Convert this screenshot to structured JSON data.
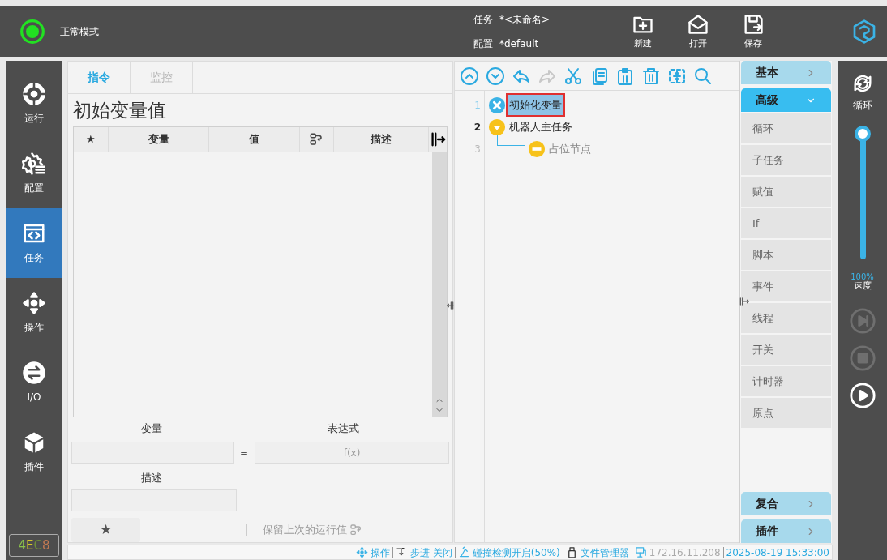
{
  "top_bar": {
    "mode": "正常模式",
    "task_label": "任务",
    "task_value": "*<未命名>",
    "config_label": "配置",
    "config_value": "*default",
    "actions": [
      {
        "kind": "new",
        "label": "新建"
      },
      {
        "kind": "open",
        "label": "打开"
      },
      {
        "kind": "save",
        "label": "保存"
      }
    ]
  },
  "nav": [
    {
      "kind": "run",
      "label": "运行",
      "selected": false
    },
    {
      "kind": "config",
      "label": "配置",
      "selected": false
    },
    {
      "kind": "task",
      "label": "任务",
      "selected": true
    },
    {
      "kind": "move",
      "label": "操作",
      "selected": false
    },
    {
      "kind": "io",
      "label": "I/O",
      "selected": false
    },
    {
      "kind": "plugin",
      "label": "插件",
      "selected": false
    }
  ],
  "badge": "4EC8",
  "tabs": [
    {
      "label": "指令",
      "selected": true
    },
    {
      "label": "监控",
      "selected": false
    }
  ],
  "panel_title": "初始变量值",
  "table": {
    "columns": [
      {
        "kind": "text",
        "label": "★"
      },
      {
        "kind": "text",
        "label": "变量"
      },
      {
        "kind": "text",
        "label": "值"
      },
      {
        "kind": "icon"
      },
      {
        "kind": "text",
        "label": "描述"
      }
    ]
  },
  "form": {
    "variable_label": "变量",
    "expression_label": "表达式",
    "equals": "=",
    "expression_placeholder": "f(x)",
    "description_label": "描述",
    "star_button": "★",
    "keep_value": {
      "label": "保留上次的运行值",
      "checked": false
    }
  },
  "toolbar": [
    {
      "kind": "up",
      "disabled": false
    },
    {
      "kind": "down",
      "disabled": false
    },
    {
      "kind": "undo",
      "disabled": false
    },
    {
      "kind": "redo",
      "disabled": true
    },
    {
      "kind": "cut",
      "disabled": false
    },
    {
      "kind": "copy",
      "disabled": false
    },
    {
      "kind": "paste",
      "disabled": false
    },
    {
      "kind": "delete",
      "disabled": false
    },
    {
      "kind": "fit",
      "disabled": false
    },
    {
      "kind": "search",
      "disabled": false
    }
  ],
  "tree": [
    {
      "line": "1",
      "kind": "init",
      "label": "初始化变量",
      "selected": true
    },
    {
      "line": "2",
      "kind": "task",
      "label": "机器人主任务",
      "selected": false,
      "children": [
        {
          "line": "3",
          "kind": "placeholder",
          "label": "占位节点",
          "selected": false
        }
      ]
    }
  ],
  "palette": [
    {
      "label": "基本",
      "expanded": false
    },
    {
      "label": "高级",
      "expanded": true,
      "items": [
        "循环",
        "子任务",
        "赋值",
        "If",
        "脚本",
        "事件",
        "线程",
        "开关",
        "计时器",
        "原点"
      ]
    },
    {
      "label": "复合",
      "expanded": false
    },
    {
      "label": "插件",
      "expanded": false
    }
  ],
  "right_bar": {
    "cycle_label": "循环",
    "speed": {
      "level": 1.0,
      "reading": "100%",
      "label": "速度"
    },
    "controls": [
      {
        "kind": "step",
        "disabled": true
      },
      {
        "kind": "stop",
        "disabled": true
      },
      {
        "kind": "play",
        "disabled": false
      }
    ]
  },
  "status_bar": [
    {
      "kind": "move",
      "label": "操作",
      "active": true
    },
    {
      "kind": "step",
      "label": "步进 关闭",
      "active": true
    },
    {
      "kind": "collision",
      "label": "碰撞检测开启(50%)",
      "active": true
    },
    {
      "kind": "usb",
      "label": "文件管理器",
      "active": true
    },
    {
      "kind": "network",
      "label": "172.16.11.208",
      "active": false
    },
    {
      "kind": "clock",
      "label": "2025-08-19 15:33:00",
      "active": true
    }
  ]
}
